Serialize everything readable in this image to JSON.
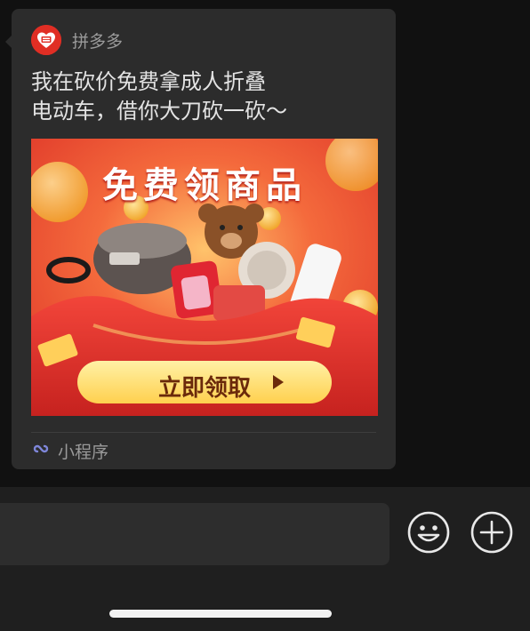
{
  "app": {
    "name": "拼多多",
    "logo_icon": "pinduoduo-logo-icon"
  },
  "message": {
    "text": "我在砍价免费拿成人折叠\n电动车，借你大刀砍一砍～"
  },
  "promo": {
    "headline": "免费领商品",
    "button_label": "立即领取",
    "colors": {
      "background": "#ea4630",
      "button": "#ffe27a",
      "button_text": "#7a2a0a"
    }
  },
  "footer": {
    "icon": "mini-program-icon",
    "label": "小程序"
  },
  "input_bar": {
    "emoji_icon": "emoji-icon",
    "plus_icon": "plus-icon"
  }
}
